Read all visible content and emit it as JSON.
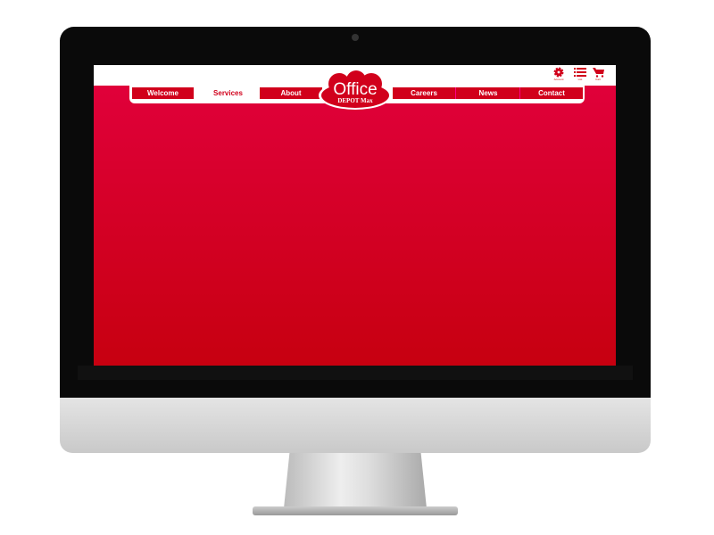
{
  "nav": {
    "tabs": [
      {
        "label": "Welcome",
        "active": false
      },
      {
        "label": "Services",
        "active": true
      },
      {
        "label": "About",
        "active": false
      },
      {
        "label": "Careers",
        "active": false
      },
      {
        "label": "News",
        "active": false
      },
      {
        "label": "Contact",
        "active": false
      }
    ]
  },
  "logo": {
    "line1": "Office",
    "line2": "DEPOT Max"
  },
  "header_icons": [
    {
      "icon": "gear-icon",
      "label": "Account"
    },
    {
      "icon": "list-icon",
      "label": "List"
    },
    {
      "icon": "cart-icon",
      "label": "Cart"
    }
  ],
  "colors": {
    "brand_red": "#d1001b",
    "gradient_top": "#e2003d",
    "gradient_bottom": "#c70010"
  }
}
